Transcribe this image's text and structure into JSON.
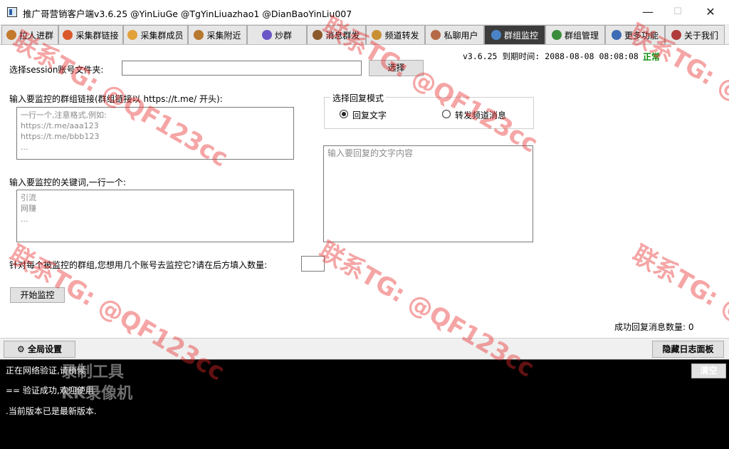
{
  "window": {
    "title": "推广哥营销客户端v3.6.25 @YinLiuGe @TgYinLiuazhao1 @DianBaoYinLiu007",
    "minimize": "—",
    "maximize": "☐",
    "close": "✕"
  },
  "tabs": [
    {
      "label": "拉人进群",
      "color": "#c47a2c"
    },
    {
      "label": "采集群链接",
      "color": "#d9572b"
    },
    {
      "label": "采集群成员",
      "color": "#e2a13b"
    },
    {
      "label": "采集附近",
      "color": "#b7782f"
    },
    {
      "label": "炒群",
      "color": "#6a56c7"
    },
    {
      "label": "消息群发",
      "color": "#8c5a2b"
    },
    {
      "label": "频道转发",
      "color": "#c98f35"
    },
    {
      "label": "私聊用户",
      "color": "#b46a46"
    },
    {
      "label": "群组监控",
      "color": "#4a84c6",
      "active": true
    },
    {
      "label": "群组管理",
      "color": "#3b8d3b"
    },
    {
      "label": "更多功能",
      "color": "#3c6cb4"
    },
    {
      "label": "关于我们",
      "color": "#b03b3b"
    }
  ],
  "status": {
    "version": "v3.6.25",
    "expiry_label": "到期时间:",
    "expiry_value": "2088-08-08 08:08:08",
    "state": "正常",
    "state_color": "#0a8a0a"
  },
  "session": {
    "label": "选择session账号文件夹:",
    "value": "",
    "browse_button": "选择"
  },
  "links": {
    "label": "输入要监控的群组链接(群组链接以 https://t.me/ 开头):",
    "placeholder": "一行一个,注意格式,例如:\nhttps://t.me/aaa123\nhttps://t.me/bbb123\n..."
  },
  "keywords": {
    "label": "输入要监控的关键词,一行一个:",
    "placeholder": "引流\n网赚\n..."
  },
  "reply_mode": {
    "title": "选择回复模式",
    "option_text": "回复文字",
    "option_forward": "转发频道消息",
    "selected": "text"
  },
  "reply_text": {
    "placeholder": "输入要回复的文字内容"
  },
  "accounts": {
    "label": "针对每个被监控的群组,您想用几个账号去监控它?请在后方填入数量:",
    "value": ""
  },
  "start_button": "开始监控",
  "success_count": {
    "label": "成功回复消息数量:",
    "value": "0"
  },
  "bottom": {
    "global_settings": "全局设置",
    "hide_log": "隐藏日志面板"
  },
  "log": {
    "clear_button": "清空",
    "lines": [
      "正在网络验证,请稍候",
      "==   验证成功,欢迎使用",
      ".当前版本已是最新版本."
    ]
  },
  "recorder_overlay": {
    "line1": "录制工具",
    "line2": "KK录像机"
  },
  "watermark_text": "联系TG: @QF123cc"
}
